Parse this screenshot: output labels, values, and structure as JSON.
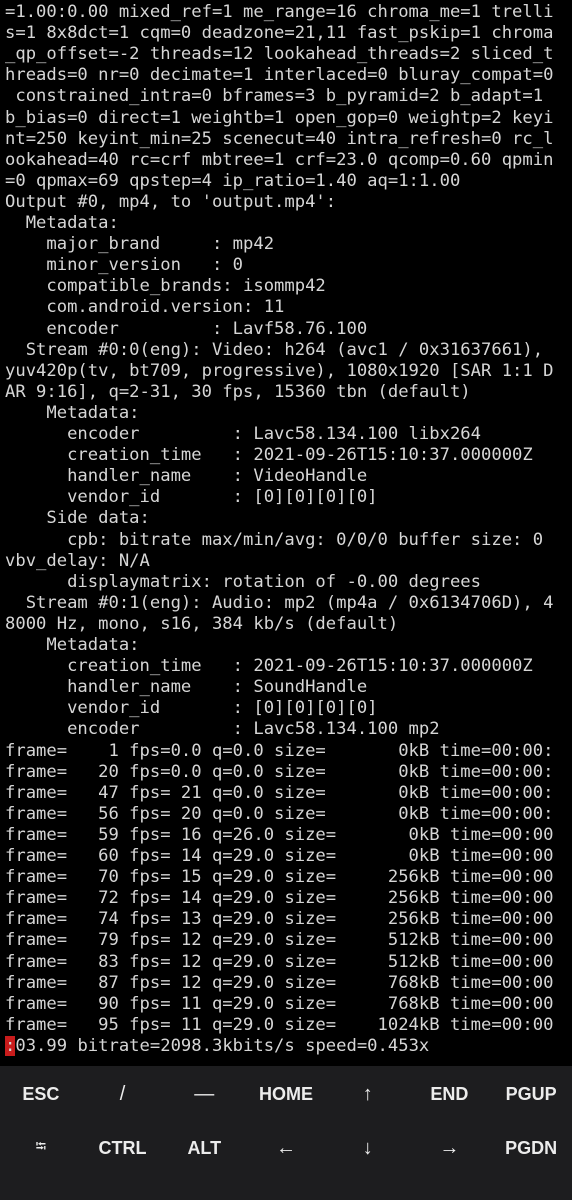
{
  "terminal": {
    "lines": [
      "=1.00:0.00 mixed_ref=1 me_range=16 chroma_me=1 trelli",
      "s=1 8x8dct=1 cqm=0 deadzone=21,11 fast_pskip=1 chroma",
      "_qp_offset=-2 threads=12 lookahead_threads=2 sliced_t",
      "hreads=0 nr=0 decimate=1 interlaced=0 bluray_compat=0",
      " constrained_intra=0 bframes=3 b_pyramid=2 b_adapt=1",
      "b_bias=0 direct=1 weightb=1 open_gop=0 weightp=2 keyi",
      "nt=250 keyint_min=25 scenecut=40 intra_refresh=0 rc_l",
      "ookahead=40 rc=crf mbtree=1 crf=23.0 qcomp=0.60 qpmin",
      "=0 qpmax=69 qpstep=4 ip_ratio=1.40 aq=1:1.00",
      "Output #0, mp4, to 'output.mp4':",
      "  Metadata:",
      "    major_brand     : mp42",
      "    minor_version   : 0",
      "    compatible_brands: isommp42",
      "    com.android.version: 11",
      "    encoder         : Lavf58.76.100",
      "  Stream #0:0(eng): Video: h264 (avc1 / 0x31637661),",
      "yuv420p(tv, bt709, progressive), 1080x1920 [SAR 1:1 D",
      "AR 9:16], q=2-31, 30 fps, 15360 tbn (default)",
      "    Metadata:",
      "      encoder         : Lavc58.134.100 libx264",
      "      creation_time   : 2021-09-26T15:10:37.000000Z",
      "      handler_name    : VideoHandle",
      "      vendor_id       : [0][0][0][0]",
      "    Side data:",
      "      cpb: bitrate max/min/avg: 0/0/0 buffer size: 0",
      "vbv_delay: N/A",
      "      displaymatrix: rotation of -0.00 degrees",
      "  Stream #0:1(eng): Audio: mp2 (mp4a / 0x6134706D), 4",
      "8000 Hz, mono, s16, 384 kb/s (default)",
      "    Metadata:",
      "      creation_time   : 2021-09-26T15:10:37.000000Z",
      "      handler_name    : SoundHandle",
      "      vendor_id       : [0][0][0][0]",
      "      encoder         : Lavc58.134.100 mp2",
      "frame=    1 fps=0.0 q=0.0 size=       0kB time=00:00:",
      "frame=   20 fps=0.0 q=0.0 size=       0kB time=00:00:",
      "frame=   47 fps= 21 q=0.0 size=       0kB time=00:00:",
      "frame=   56 fps= 20 q=0.0 size=       0kB time=00:00:",
      "frame=   59 fps= 16 q=26.0 size=       0kB time=00:00",
      "frame=   60 fps= 14 q=29.0 size=       0kB time=00:00",
      "frame=   70 fps= 15 q=29.0 size=     256kB time=00:00",
      "frame=   72 fps= 14 q=29.0 size=     256kB time=00:00",
      "frame=   74 fps= 13 q=29.0 size=     256kB time=00:00",
      "frame=   79 fps= 12 q=29.0 size=     512kB time=00:00",
      "frame=   83 fps= 12 q=29.0 size=     512kB time=00:00",
      "frame=   87 fps= 12 q=29.0 size=     768kB time=00:00",
      "frame=   90 fps= 11 q=29.0 size=     768kB time=00:00",
      "frame=   95 fps= 11 q=29.0 size=    1024kB time=00:00"
    ],
    "prompt": {
      "cursor_char": ":",
      "rest": "03.99 bitrate=2098.3kbits/s speed=0.453x"
    }
  },
  "extra_keys": {
    "row1": [
      {
        "label": "ESC"
      },
      {
        "label": "/"
      },
      {
        "label": "—"
      },
      {
        "label": "HOME"
      },
      {
        "label": "↑"
      },
      {
        "label": "END"
      },
      {
        "label": "PGUP"
      }
    ],
    "row2": [
      {
        "label": "⭾",
        "icon": "tab-icon"
      },
      {
        "label": "CTRL"
      },
      {
        "label": "ALT"
      },
      {
        "label": "←"
      },
      {
        "label": "↓"
      },
      {
        "label": "→"
      },
      {
        "label": "PGDN"
      }
    ]
  },
  "colors": {
    "background": "#000000",
    "text": "#d6d6d6",
    "cursor": "#c91c1c",
    "keybar": "#1d1d1f",
    "key_text": "#ececec"
  }
}
